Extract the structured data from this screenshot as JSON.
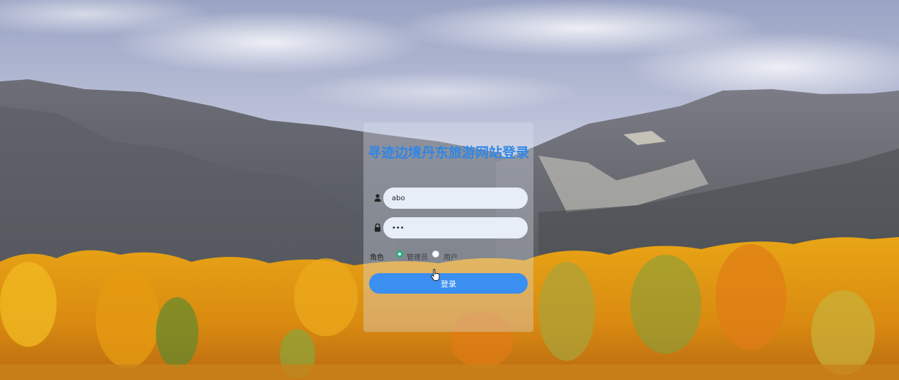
{
  "login": {
    "title": "寻迹边境丹东旅游网站登录",
    "username": {
      "value": "abo"
    },
    "password": {
      "value": "•••"
    },
    "role": {
      "label": "角色",
      "options": [
        {
          "label": "管理员",
          "checked": true
        },
        {
          "label": "用户",
          "checked": false
        }
      ]
    },
    "submit_label": "登录"
  },
  "icons": {
    "username": "user-icon",
    "password": "lock-icon",
    "cursor": "hand-pointer-icon"
  },
  "colors": {
    "title": "#2f86e6",
    "button": "#3a8ff0",
    "radio_checked": "#26b07a",
    "input_bg": "#e8eef8"
  }
}
